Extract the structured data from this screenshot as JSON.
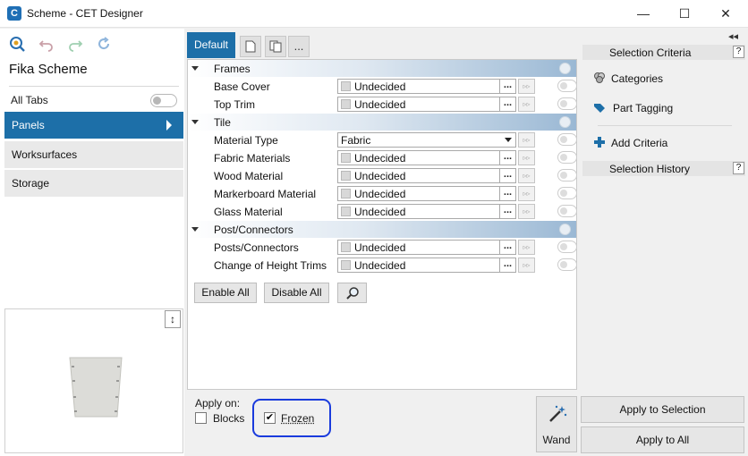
{
  "window": {
    "title": "Scheme - CET Designer",
    "app_icon": "C",
    "controls": {
      "minimize": "—",
      "maximize": "☐",
      "close": "✕"
    }
  },
  "left": {
    "toolbar_icons": [
      "magnifier-icon",
      "undo-icon",
      "redo-icon",
      "refresh-icon"
    ],
    "scheme_name": "Fika Scheme",
    "all_tabs_label": "All Tabs",
    "all_tabs_on": false,
    "categories": [
      {
        "label": "Panels",
        "active": true
      },
      {
        "label": "Worksurfaces",
        "active": false
      },
      {
        "label": "Storage",
        "active": false
      }
    ],
    "resize_glyph": "↕"
  },
  "tabs": {
    "default_label": "Default",
    "more_label": "..."
  },
  "groups": {
    "frames": "Frames",
    "tile": "Tile",
    "posts": "Post/Connectors"
  },
  "props": {
    "base_cover": {
      "label": "Base Cover",
      "value": "Undecided"
    },
    "top_trim": {
      "label": "Top Trim",
      "value": "Undecided"
    },
    "material_type": {
      "label": "Material Type",
      "value": "Fabric"
    },
    "fabric_materials": {
      "label": "Fabric Materials",
      "value": "Undecided"
    },
    "wood_material": {
      "label": "Wood Material",
      "value": "Undecided"
    },
    "markerboard_material": {
      "label": "Markerboard Material",
      "value": "Undecided"
    },
    "glass_material": {
      "label": "Glass Material",
      "value": "Undecided"
    },
    "posts_connectors": {
      "label": "Posts/Connectors",
      "value": "Undecided"
    },
    "change_height_trims": {
      "label": "Change of Height Trims",
      "value": "Undecided"
    }
  },
  "dots_label": "...",
  "pass_glyph": "▹▹",
  "actions": {
    "enable_all": "Enable All",
    "disable_all": "Disable All",
    "apply_on": "Apply on:",
    "blocks": "Blocks",
    "frozen": "Frozen",
    "frozen_checked": true,
    "wand": "Wand",
    "apply_selection": "Apply to Selection",
    "apply_all": "Apply to All"
  },
  "right": {
    "collapse_glyph": "◂◂",
    "selection_criteria": "Selection Criteria",
    "categories": "Categories",
    "part_tagging": "Part Tagging",
    "add_criteria": "Add Criteria",
    "selection_history": "Selection History",
    "help": "?"
  },
  "colors": {
    "accent": "#1d6fa8",
    "highlight_ring": "#1a3bdd"
  }
}
